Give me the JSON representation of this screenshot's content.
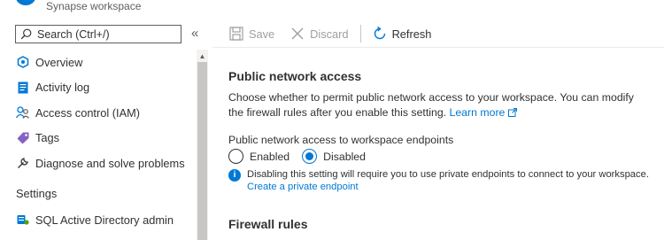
{
  "header": {
    "subtitle": "Synapse workspace"
  },
  "sidebar": {
    "search_placeholder": "Search (Ctrl+/)",
    "collapse_glyph": "«",
    "items": [
      {
        "label": "Overview",
        "icon": "overview-icon"
      },
      {
        "label": "Activity log",
        "icon": "activity-log-icon"
      },
      {
        "label": "Access control (IAM)",
        "icon": "iam-icon"
      },
      {
        "label": "Tags",
        "icon": "tag-icon"
      },
      {
        "label": "Diagnose and solve problems",
        "icon": "wrench-icon"
      }
    ],
    "section_settings": "Settings",
    "settings_items": [
      {
        "label": "SQL Active Directory admin",
        "icon": "sql-admin-icon"
      }
    ]
  },
  "toolbar": {
    "save": "Save",
    "discard": "Discard",
    "refresh": "Refresh"
  },
  "main": {
    "section_title": "Public network access",
    "description": "Choose whether to permit public network access to your workspace. You can modify the firewall rules after you enable this setting.",
    "learn_more": "Learn more",
    "field_label": "Public network access to workspace endpoints",
    "options": [
      "Enabled",
      "Disabled"
    ],
    "selected_option": "Disabled",
    "info_text": "Disabling this setting will require you to use private endpoints to connect to your workspace.",
    "info_link": "Create a private endpoint",
    "firewall_title": "Firewall rules"
  },
  "colors": {
    "accent": "#0078d4",
    "disabled_text": "#a19f9d",
    "text": "#323130"
  }
}
